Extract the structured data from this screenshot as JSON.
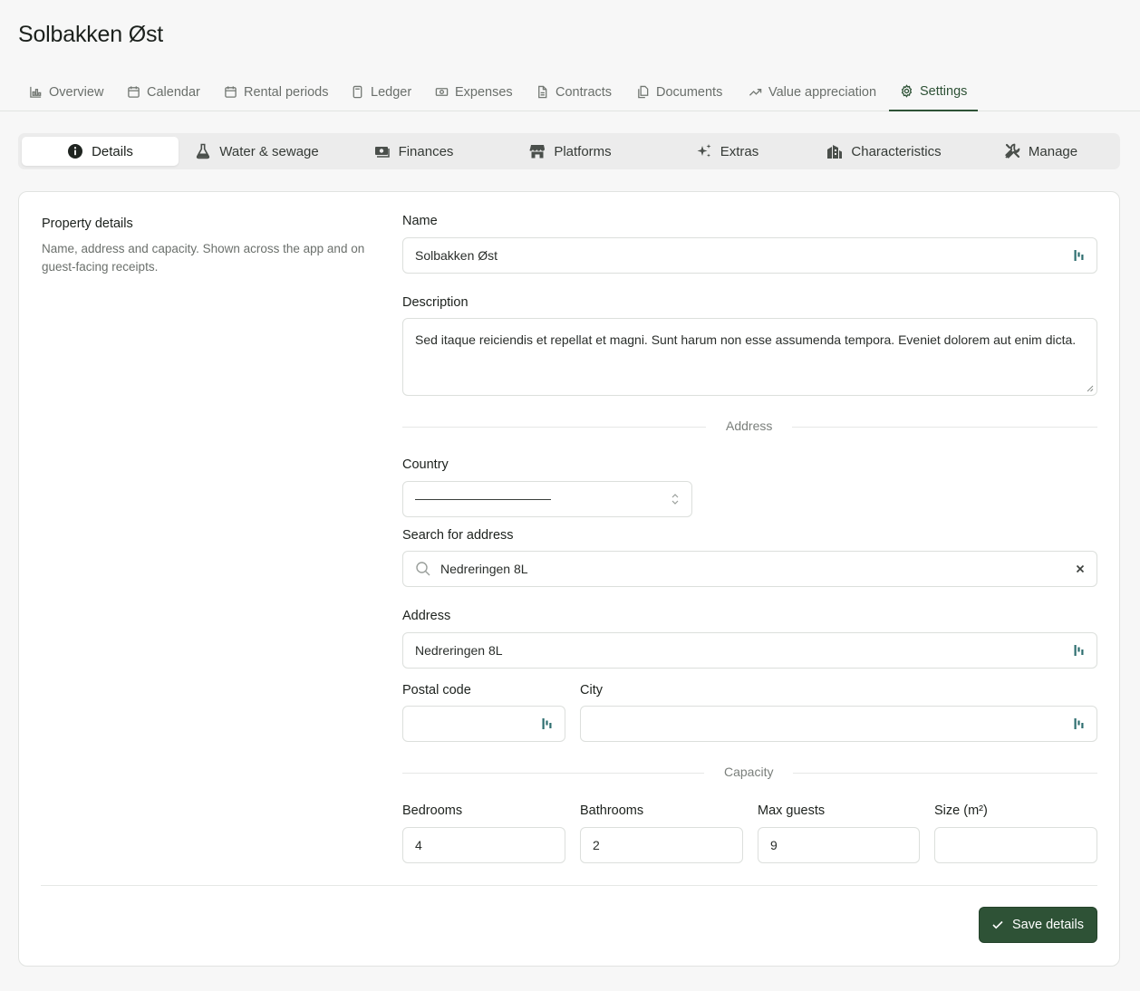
{
  "page": {
    "title": "Solbakken Øst"
  },
  "topnav": {
    "tabs": [
      {
        "label": "Overview",
        "icon": "bar-chart-icon"
      },
      {
        "label": "Calendar",
        "icon": "calendar-icon"
      },
      {
        "label": "Rental periods",
        "icon": "calendar-icon"
      },
      {
        "label": "Ledger",
        "icon": "calculator-icon"
      },
      {
        "label": "Expenses",
        "icon": "banknote-icon"
      },
      {
        "label": "Contracts",
        "icon": "file-icon"
      },
      {
        "label": "Documents",
        "icon": "files-icon"
      },
      {
        "label": "Value appreciation",
        "icon": "trending-up-icon"
      },
      {
        "label": "Settings",
        "icon": "gear-icon",
        "active": true
      }
    ]
  },
  "subtabs": {
    "items": [
      {
        "label": "Details",
        "icon": "info-icon",
        "active": true
      },
      {
        "label": "Water & sewage",
        "icon": "flask-icon"
      },
      {
        "label": "Finances",
        "icon": "money-icon"
      },
      {
        "label": "Platforms",
        "icon": "store-icon"
      },
      {
        "label": "Extras",
        "icon": "sparkles-icon"
      },
      {
        "label": "Characteristics",
        "icon": "building-icon"
      },
      {
        "label": "Manage",
        "icon": "tools-icon"
      }
    ]
  },
  "details": {
    "section_title": "Property details",
    "section_desc": "Name, address and capacity. Shown across the app and on guest-facing receipts.",
    "name_label": "Name",
    "name_value": "Solbakken Øst",
    "description_label": "Description",
    "description_value": "Sed itaque reiciendis et repellat et magni. Sunt harum non esse assumenda tempora. Eveniet dolorem aut enim dicta.",
    "address_divider": "Address",
    "country_label": "Country",
    "search_label": "Search for address",
    "search_value": "Nedreringen 8L",
    "address_label": "Address",
    "address_value": "Nedreringen 8L",
    "postal_label": "Postal code",
    "postal_value": "",
    "city_label": "City",
    "city_value": "",
    "capacity_divider": "Capacity",
    "bedrooms_label": "Bedrooms",
    "bedrooms_value": "4",
    "bathrooms_label": "Bathrooms",
    "bathrooms_value": "2",
    "max_guests_label": "Max guests",
    "max_guests_value": "9",
    "size_label": "Size (m²)",
    "size_value": "",
    "save_label": "Save details"
  },
  "colors": {
    "accent": "#2e5236",
    "password_manager_icon": "#2f6f70"
  }
}
